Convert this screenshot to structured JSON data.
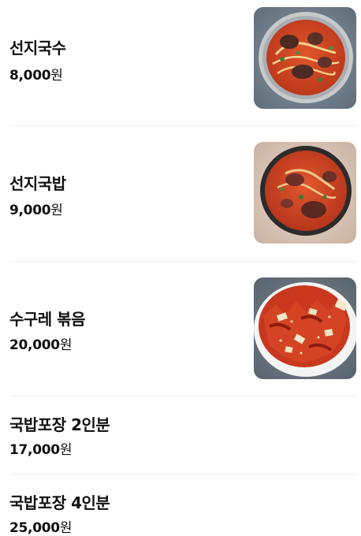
{
  "menu": {
    "items": [
      {
        "name": "선지국수",
        "price_number": "8,000",
        "price_unit": "원",
        "photo": "bowl-spicy-noodle-soup"
      },
      {
        "name": "선지국밥",
        "price_number": "9,000",
        "price_unit": "원",
        "photo": "bowl-spicy-rice-soup"
      },
      {
        "name": "수구레 볶음",
        "price_number": "20,000",
        "price_unit": "원",
        "photo": "plate-stir-fry"
      },
      {
        "name": "국밥포장 2인분",
        "price_number": "17,000",
        "price_unit": "원"
      },
      {
        "name": "국밥포장 4인분",
        "price_number": "25,000",
        "price_unit": "원"
      }
    ]
  },
  "colors": {
    "divider": "#eeeeee",
    "text": "#111111",
    "soup_red": "#d0431f"
  }
}
